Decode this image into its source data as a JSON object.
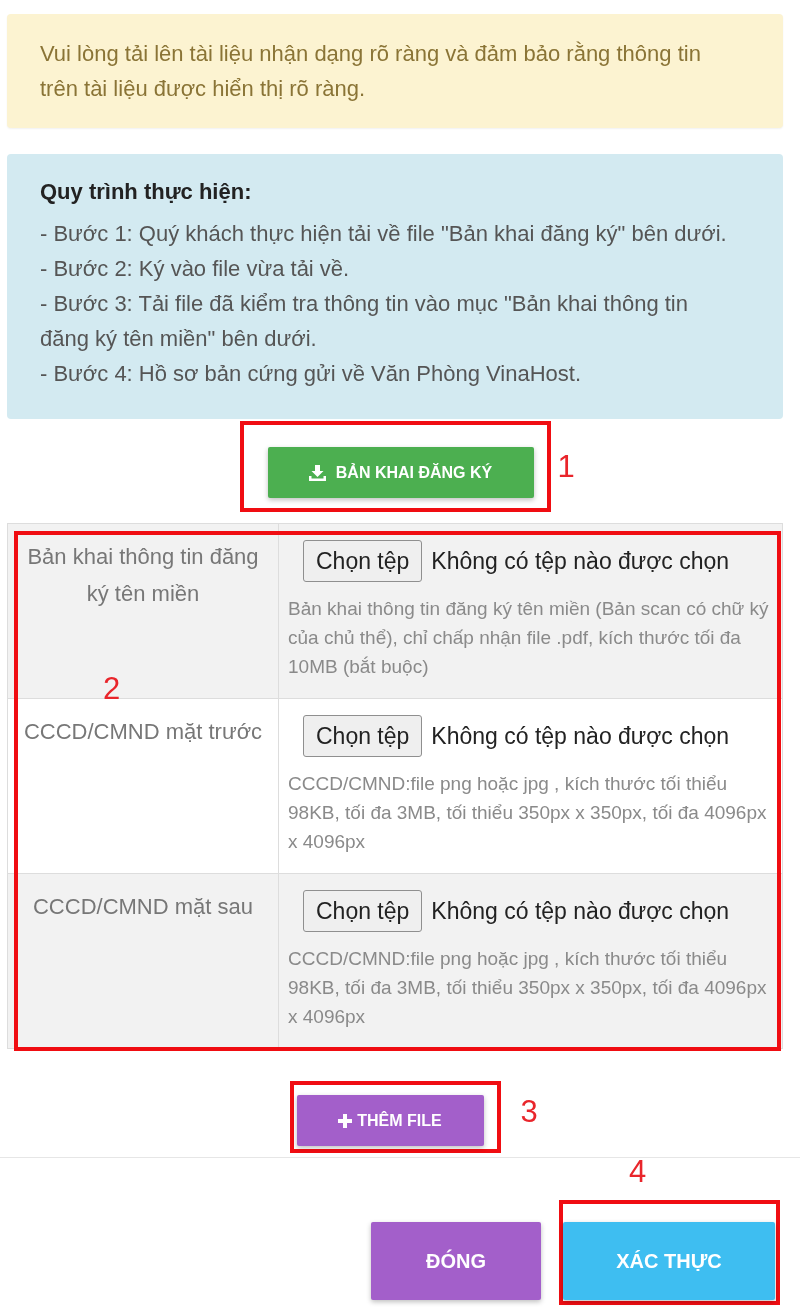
{
  "notice": {
    "text": "Vui lòng tải lên tài liệu nhận dạng rõ ràng và đảm bảo rằng thông tin trên tài liệu được hiển thị rõ ràng."
  },
  "procedure": {
    "title": "Quy trình thực hiện:",
    "steps": [
      "- Bước 1: Quý khách thực hiện tải về file \"Bản khai đăng ký\" bên dưới.",
      "- Bước 2: Ký vào file vừa tải về.",
      "- Bước 3: Tải file đã kiểm tra thông tin vào mục \"Bản khai thông tin đăng ký tên miền\" bên dưới.",
      "- Bước 4: Hồ sơ bản cứng gửi về Văn Phòng VinaHost."
    ]
  },
  "download_button": {
    "label": "BẢN KHAI ĐĂNG KÝ",
    "callout": "1"
  },
  "upload_table": {
    "callout": "2",
    "rows": [
      {
        "label": "Bản khai thông tin đăng ký tên miền",
        "button": "Chọn tệp",
        "status": "Không có tệp nào được chọn",
        "hint": "Bản khai thông tin đăng ký tên miền (Bản scan có chữ ký của chủ thể), chỉ chấp nhận file .pdf, kích thước tối đa 10MB (bắt buộc)"
      },
      {
        "label": "CCCD/CMND mặt trước",
        "button": "Chọn tệp",
        "status": "Không có tệp nào được chọn",
        "hint": "CCCD/CMND:file png hoặc jpg , kích thước tối thiểu 98KB, tối đa 3MB, tối thiểu 350px x 350px, tối đa 4096px x 4096px"
      },
      {
        "label": "CCCD/CMND mặt sau",
        "button": "Chọn tệp",
        "status": "Không có tệp nào được chọn",
        "hint": "CCCD/CMND:file png hoặc jpg , kích thước tối thiểu 98KB, tối đa 3MB, tối thiểu 350px x 350px, tối đa 4096px x 4096px"
      }
    ]
  },
  "add_file_button": {
    "label": "THÊM FILE",
    "callout": "3"
  },
  "footer_buttons": [
    {
      "kind": "close",
      "label": "ĐÓNG"
    },
    {
      "kind": "confirm",
      "label": "XÁC THỰC",
      "callout": "4"
    }
  ]
}
